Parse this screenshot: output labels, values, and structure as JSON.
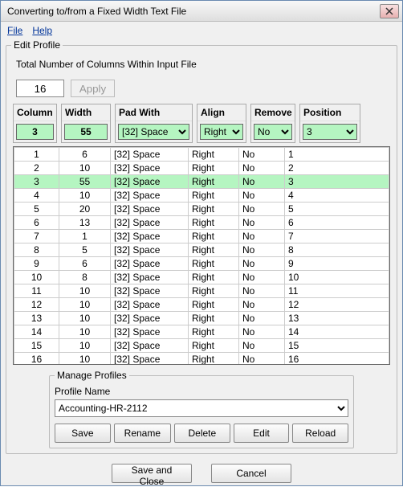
{
  "window_title": "Converting to/from a Fixed Width Text File",
  "menu": {
    "file": "File",
    "help": "Help"
  },
  "edit_profile_legend": "Edit Profile",
  "total_columns_label": "Total Number of Columns Within Input File",
  "total_columns_value": "16",
  "apply_label": "Apply",
  "headers": {
    "column": "Column",
    "width": "Width",
    "pad": "Pad With",
    "align": "Align",
    "remove": "Remove",
    "position": "Position"
  },
  "header_values": {
    "column": "3",
    "width": "55",
    "pad": "[32] Space",
    "align": "Right",
    "remove": "No",
    "position": "3"
  },
  "selected_row_index": 2,
  "rows": [
    {
      "column": "1",
      "width": "6",
      "pad": "[32] Space",
      "align": "Right",
      "remove": "No",
      "position": "1"
    },
    {
      "column": "2",
      "width": "10",
      "pad": "[32] Space",
      "align": "Right",
      "remove": "No",
      "position": "2"
    },
    {
      "column": "3",
      "width": "55",
      "pad": "[32] Space",
      "align": "Right",
      "remove": "No",
      "position": "3"
    },
    {
      "column": "4",
      "width": "10",
      "pad": "[32] Space",
      "align": "Right",
      "remove": "No",
      "position": "4"
    },
    {
      "column": "5",
      "width": "20",
      "pad": "[32] Space",
      "align": "Right",
      "remove": "No",
      "position": "5"
    },
    {
      "column": "6",
      "width": "13",
      "pad": "[32] Space",
      "align": "Right",
      "remove": "No",
      "position": "6"
    },
    {
      "column": "7",
      "width": "1",
      "pad": "[32] Space",
      "align": "Right",
      "remove": "No",
      "position": "7"
    },
    {
      "column": "8",
      "width": "5",
      "pad": "[32] Space",
      "align": "Right",
      "remove": "No",
      "position": "8"
    },
    {
      "column": "9",
      "width": "6",
      "pad": "[32] Space",
      "align": "Right",
      "remove": "No",
      "position": "9"
    },
    {
      "column": "10",
      "width": "8",
      "pad": "[32] Space",
      "align": "Right",
      "remove": "No",
      "position": "10"
    },
    {
      "column": "11",
      "width": "10",
      "pad": "[32] Space",
      "align": "Right",
      "remove": "No",
      "position": "11"
    },
    {
      "column": "12",
      "width": "10",
      "pad": "[32] Space",
      "align": "Right",
      "remove": "No",
      "position": "12"
    },
    {
      "column": "13",
      "width": "10",
      "pad": "[32] Space",
      "align": "Right",
      "remove": "No",
      "position": "13"
    },
    {
      "column": "14",
      "width": "10",
      "pad": "[32] Space",
      "align": "Right",
      "remove": "No",
      "position": "14"
    },
    {
      "column": "15",
      "width": "10",
      "pad": "[32] Space",
      "align": "Right",
      "remove": "No",
      "position": "15"
    },
    {
      "column": "16",
      "width": "10",
      "pad": "[32] Space",
      "align": "Right",
      "remove": "No",
      "position": "16"
    }
  ],
  "manage": {
    "legend": "Manage Profiles",
    "profile_name_label": "Profile Name",
    "profile_name_value": "Accounting-HR-2112",
    "save": "Save",
    "rename": "Rename",
    "delete": "Delete",
    "edit": "Edit",
    "reload": "Reload"
  },
  "save_and_close": "Save and Close",
  "cancel": "Cancel"
}
